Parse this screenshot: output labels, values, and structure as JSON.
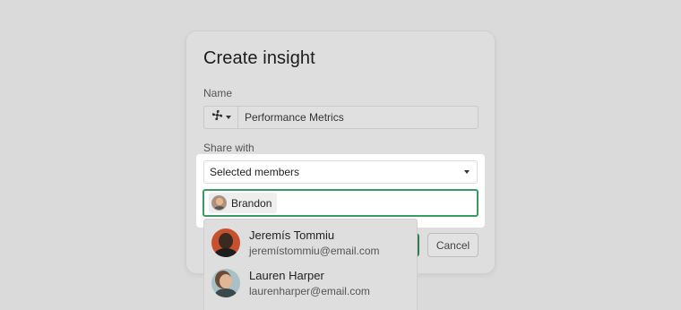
{
  "dialog": {
    "title": "Create insight",
    "name_label": "Name",
    "name_value": "Performance Metrics",
    "name_icon": "fan-icon",
    "share_label": "Share with",
    "cancel_label": "Cancel"
  },
  "share": {
    "selected_option": "Selected members",
    "chips": [
      {
        "name": "Brandon"
      }
    ]
  },
  "dropdown": {
    "options": [
      {
        "name": "Jeremís Tommiu",
        "email": "jeremístommiu@email.com"
      },
      {
        "name": "Lauren Harper",
        "email": "laurenharper@email.com"
      }
    ]
  },
  "colors": {
    "accent": "#3a9a63",
    "create_button": "#2e7d4f"
  }
}
